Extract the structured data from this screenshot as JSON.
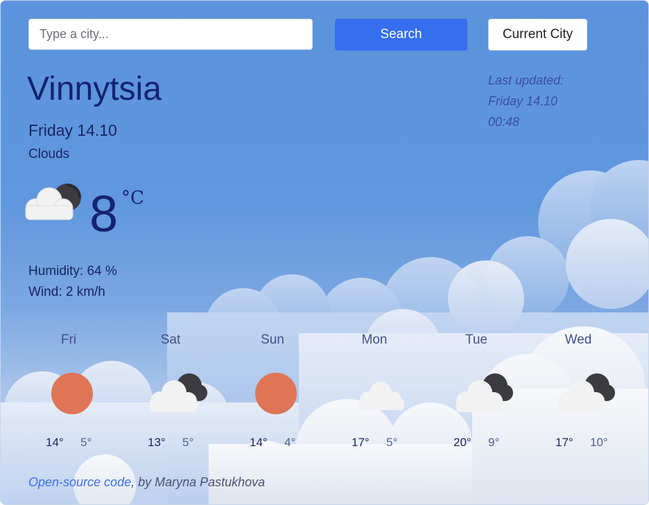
{
  "search": {
    "placeholder": "Type a city...",
    "value": ""
  },
  "buttons": {
    "search_label": "Search",
    "current_label": "Current City"
  },
  "current": {
    "city": "Vinnytsia",
    "date": "Friday 14.10",
    "description": "Clouds",
    "temperature": "8",
    "unit": "°C",
    "icon": "cloud-moon-icon",
    "humidity_text": "Humidity: 64 %",
    "wind_text": "Wind: 2 km/h"
  },
  "last_updated": {
    "label": "Last updated:",
    "day": "Friday 14.10",
    "time": "00:48"
  },
  "forecast": [
    {
      "day": "Fri",
      "icon": "sun-icon",
      "max": "14°",
      "min": "5°"
    },
    {
      "day": "Sat",
      "icon": "cloud-moon-icon",
      "max": "13°",
      "min": "5°"
    },
    {
      "day": "Sun",
      "icon": "sun-icon",
      "max": "14°",
      "min": "4°"
    },
    {
      "day": "Mon",
      "icon": "cloud-icon",
      "max": "17°",
      "min": "5°"
    },
    {
      "day": "Tue",
      "icon": "cloud-moon-icon",
      "max": "20°",
      "min": "9°"
    },
    {
      "day": "Wed",
      "icon": "cloud-moon-icon",
      "max": "17°",
      "min": "10°"
    }
  ],
  "footer": {
    "link_text": "Open-source code",
    "author_text": ", by Maryna Pastukhova"
  },
  "colors": {
    "accent": "#356ff0",
    "city_text": "#152270",
    "sun": "#df7556",
    "moon": "#3c3c40",
    "cloud": "#f2f2f2"
  }
}
